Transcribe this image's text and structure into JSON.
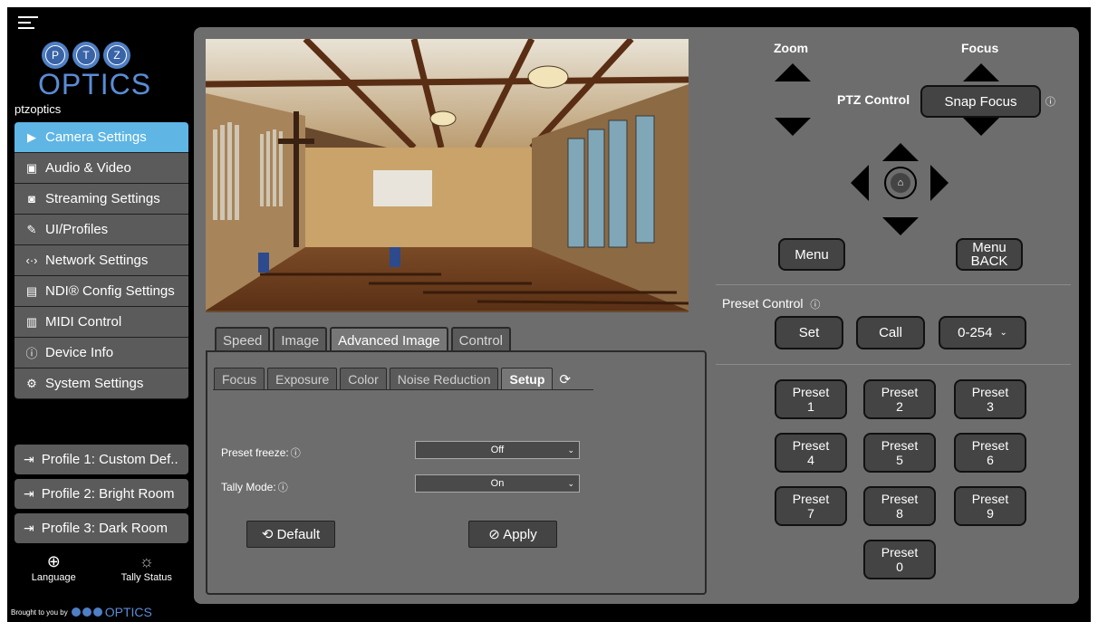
{
  "brand": {
    "name": "ptzoptics",
    "logo_letters": [
      "P",
      "T",
      "Z"
    ],
    "logo_word": "OPTICS"
  },
  "nav": [
    {
      "label": "Camera Settings",
      "icon": "camera-icon",
      "glyph": "▶",
      "active": true
    },
    {
      "label": "Audio & Video",
      "icon": "audio-video-icon",
      "glyph": "▣",
      "active": false
    },
    {
      "label": "Streaming Settings",
      "icon": "streaming-icon",
      "glyph": "◙",
      "active": false
    },
    {
      "label": "UI/Profiles",
      "icon": "palette-icon",
      "glyph": "✎",
      "active": false
    },
    {
      "label": "Network Settings",
      "icon": "network-icon",
      "glyph": "‹·›",
      "active": false
    },
    {
      "label": "NDI® Config Settings",
      "icon": "ndi-icon",
      "glyph": "▤",
      "active": false
    },
    {
      "label": "MIDI Control",
      "icon": "midi-icon",
      "glyph": "▥",
      "active": false
    },
    {
      "label": "Device Info",
      "icon": "info-icon",
      "glyph": "ⓘ",
      "active": false
    },
    {
      "label": "System Settings",
      "icon": "gear-icon",
      "glyph": "⚙",
      "active": false
    }
  ],
  "profiles": [
    {
      "label": "Profile 1: Custom Def.."
    },
    {
      "label": "Profile 2: Bright Room"
    },
    {
      "label": "Profile 3: Dark Room"
    }
  ],
  "tools": {
    "language": "Language",
    "tally": "Tally Status"
  },
  "brought_by": "Brought to you by",
  "tabs": [
    "Speed",
    "Image",
    "Advanced Image",
    "Control"
  ],
  "subtabs": [
    "Focus",
    "Exposure",
    "Color",
    "Noise Reduction",
    "Setup"
  ],
  "form": {
    "preset_freeze_label": "Preset freeze:",
    "preset_freeze_value": "Off",
    "tally_mode_label": "Tally Mode:",
    "tally_mode_value": "On"
  },
  "buttons": {
    "default": "⟲ Default",
    "apply": "⊘ Apply"
  },
  "controls": {
    "zoom": "Zoom",
    "focus": "Focus",
    "ptz_control": "PTZ Control",
    "snap_focus": "Snap Focus",
    "menu": "Menu",
    "menu_back_line1": "Menu",
    "menu_back_line2": "BACK",
    "preset_control": "Preset Control",
    "set": "Set",
    "call": "Call",
    "preset_range": "0-254"
  },
  "presets": [
    {
      "label": "Preset",
      "num": "1"
    },
    {
      "label": "Preset",
      "num": "2"
    },
    {
      "label": "Preset",
      "num": "3"
    },
    {
      "label": "Preset",
      "num": "4"
    },
    {
      "label": "Preset",
      "num": "5"
    },
    {
      "label": "Preset",
      "num": "6"
    },
    {
      "label": "Preset",
      "num": "7"
    },
    {
      "label": "Preset",
      "num": "8"
    },
    {
      "label": "Preset",
      "num": "9"
    },
    {
      "label": "Preset",
      "num": "0"
    }
  ],
  "colors": {
    "accent": "#5fb6e4",
    "panel": "#6d6d6d",
    "button": "#444444"
  }
}
